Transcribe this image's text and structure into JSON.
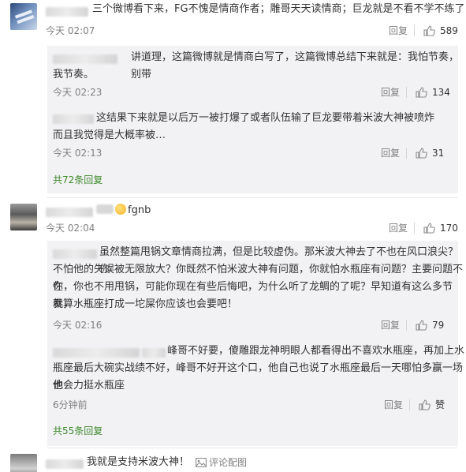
{
  "comments": [
    {
      "text": "三个微博看下来，FG不愧是情商作者；雕哥天天读情商；巨龙就是不看不学不练了",
      "time": "今天 02:07",
      "reply_label": "回复",
      "likes": "589",
      "replies": [
        {
          "text_line1": "讲道理，这篇微博就是情商白写了，这篇微博总结下来就是：我怕节奏，别带",
          "text_line2": "我节奏。",
          "time": "今天 02:23",
          "reply_label": "回复",
          "likes": "134"
        },
        {
          "text_line1": "这结果下来就是以后万一被打爆了或者队伍输了巨龙要带着米波大神被喷炸",
          "text_line2": "而且我觉得是大概率被…",
          "time": "今天 02:13",
          "reply_label": "回复",
          "likes": "31"
        }
      ],
      "more_replies": "共72条回复"
    },
    {
      "text": "fgnb",
      "time": "今天 02:04",
      "reply_label": "回复",
      "likes": "170",
      "replies": [
        {
          "text_line1": "虽然整篇甩锅文章情商拉满，但是比较虚伪。那米波大神去了不也在风口浪尖？你",
          "text_line2": "不怕他的失误被无限放大？你既然不怕米波大神有问题，你就怕水瓶座有问题？主要问题不在",
          "text_line3": "你，你也不用甩锅，可能你现在有些后悔吧，为什么听了龙鲷的了呢？早知道有这么多节奏，",
          "text_line4": "就算水瓶座打成一坨屎你应该也会要吧！",
          "time": "今天 02:16",
          "reply_label": "回复",
          "likes": "79"
        },
        {
          "text_line1": "峰哥不好要，傻雕跟龙神明眼人都看得出不喜欢水瓶座，再加上水",
          "text_line2": "瓶座最后大碗实战绩不好，峰哥不好开这个口，他自己也说了水瓶座最后一天哪怕多赢一场他",
          "text_line3": "也会力挺水瓶座",
          "time": "6分钟前",
          "reply_label": "回复",
          "likes": "赞"
        }
      ],
      "more_replies": "共55条回复"
    },
    {
      "text": "我就是支持米波大神！",
      "comment_link": "评论配图"
    }
  ],
  "icons": {
    "like": "thumbs-up-icon",
    "image": "image-icon",
    "emoji": "smile-emoji-icon",
    "flame": "flame-icon"
  },
  "colors": {
    "link_green": "#3e8a2c",
    "meta_gray": "#808080",
    "reply_bg": "#f2f2f5"
  }
}
